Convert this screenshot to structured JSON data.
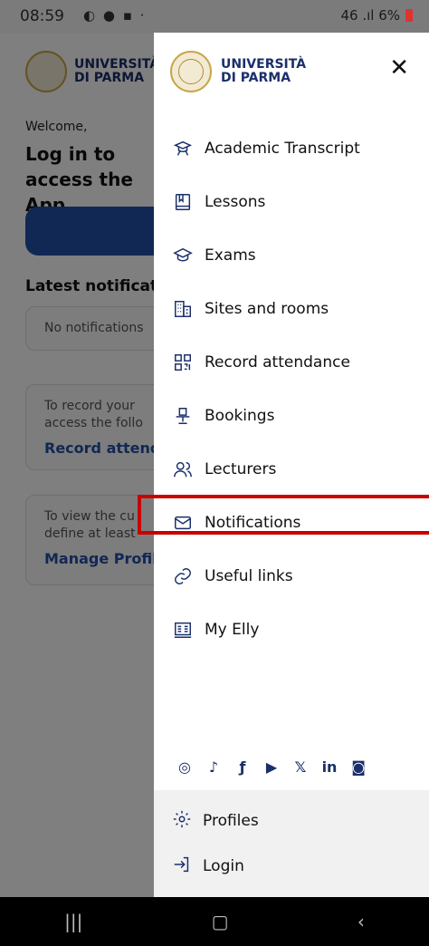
{
  "status_bar": {
    "time": "08:59",
    "right_text": "46 .ıl 6%"
  },
  "background_app": {
    "logo_line1": "UNIVERSITÀ",
    "logo_line2": "DI PARMA",
    "welcome": "Welcome,",
    "login_title": "Log in to access the App",
    "latest_heading": "Latest notifications",
    "card1_text": "No notifications",
    "card2_text": "To record your access the follo",
    "card2_link": "Record attendance",
    "card3_text": "To view the cu define at least",
    "card3_link": "Manage Profiles"
  },
  "drawer": {
    "logo_line1": "UNIVERSITÀ",
    "logo_line2": "DI PARMA",
    "close_label": "✕",
    "items": [
      {
        "label": "Academic Transcript",
        "icon": "graduate-icon"
      },
      {
        "label": "Lessons",
        "icon": "book-icon"
      },
      {
        "label": "Exams",
        "icon": "graduation-cap-icon"
      },
      {
        "label": "Sites and rooms",
        "icon": "building-icon"
      },
      {
        "label": "Record attendance",
        "icon": "qr-code-icon"
      },
      {
        "label": "Bookings",
        "icon": "desk-chair-icon"
      },
      {
        "label": "Lecturers",
        "icon": "people-icon"
      },
      {
        "label": "Notifications",
        "icon": "mail-icon"
      },
      {
        "label": "Useful links",
        "icon": "link-icon"
      },
      {
        "label": "My Elly",
        "icon": "elly-icon"
      }
    ],
    "social_icons": [
      "instagram-icon",
      "tiktok-icon",
      "facebook-icon",
      "youtube-icon",
      "x-icon",
      "linkedin-icon",
      "flickr-icon"
    ],
    "bottom": {
      "profiles_label": "Profiles",
      "login_label": "Login"
    }
  },
  "colors": {
    "brand_navy": "#1b2f6a",
    "highlight_red": "#c80000",
    "button_blue": "#2350a8"
  }
}
